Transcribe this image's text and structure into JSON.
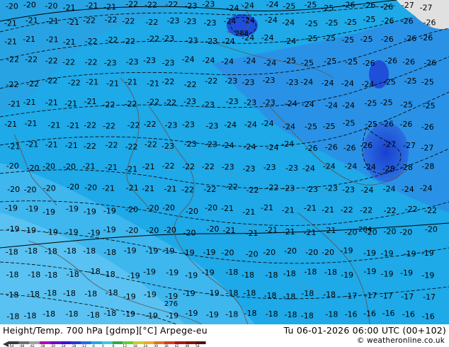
{
  "map": {
    "colors": {
      "sea": "#1ea9e8",
      "band_light": "#4fbcf0",
      "band_mid": "#2e8fe6",
      "warm_core": "#1f4fd8",
      "land": "#8be0e8",
      "contour": "#000000",
      "coast": "#555555",
      "border": "#7a7a7a",
      "north_land": "#e0e0e0"
    },
    "contour_labels": [
      {
        "t": "-18"
      },
      {
        "t": "-20"
      },
      {
        "t": "-21"
      },
      {
        "t": "-22"
      },
      {
        "t": "-23"
      },
      {
        "t": "-24"
      },
      {
        "t": "-25"
      },
      {
        "t": "-26"
      },
      {
        "t": "-27"
      },
      {
        "t": "-28"
      },
      {
        "t": "-19"
      },
      {
        "t": "-17"
      },
      {
        "t": "-16"
      }
    ],
    "high_centers": [
      {
        "label": "288"
      },
      {
        "label": "284"
      },
      {
        "label": "276"
      }
    ],
    "icon": "geopotential-temperature-map"
  },
  "footer": {
    "title": "Height/Temp. 700 hPa [gdmp][°C] Arpege-eu",
    "validity": "Tu 06-01-2026 06:00 UTC (00+102)",
    "credit": "© weatheronline.co.uk",
    "scale_values": [
      "-54",
      "-48",
      "-42",
      "-38",
      "-30",
      "-24",
      "-18",
      "-12",
      "-6",
      "0",
      "6",
      "12",
      "18",
      "24",
      "30",
      "36",
      "42",
      "48",
      "54"
    ],
    "scale_colors": [
      "#3a3a3a",
      "#6e6e6e",
      "#a0a0a0",
      "#b000b0",
      "#7000c0",
      "#4a00d8",
      "#1e3ad8",
      "#1f6fe6",
      "#1ea9e8",
      "#3cc8d8",
      "#2ca858",
      "#66cc33",
      "#cccc22",
      "#eeaa22",
      "#e07020",
      "#d83a1c",
      "#b01010",
      "#801010",
      "#501010"
    ]
  }
}
